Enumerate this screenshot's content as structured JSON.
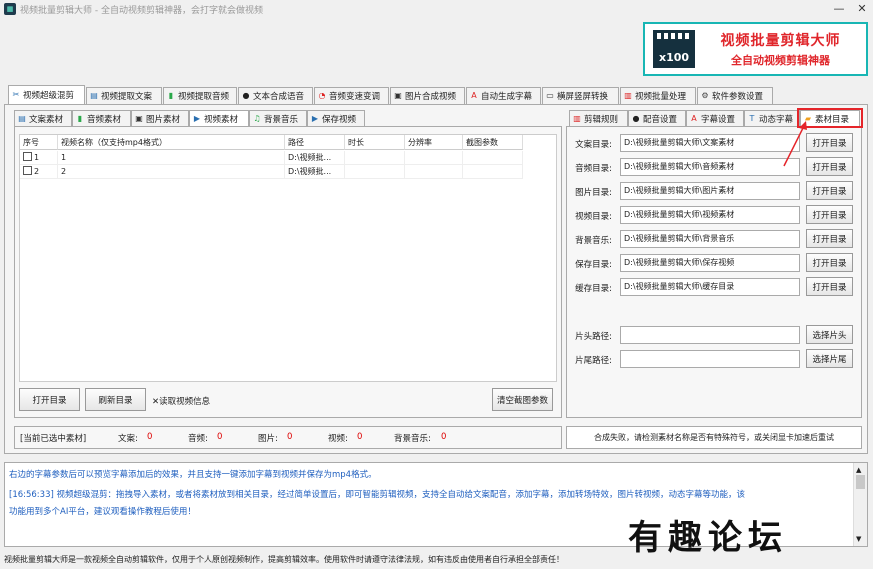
{
  "window": {
    "title": "视频批量剪辑大师 - 全自动视频剪辑神器，会打字就会做视频",
    "minimize": "—",
    "close": "✕"
  },
  "banner": {
    "logo": "x100",
    "title": "视频批量剪辑大师",
    "subtitle": "全自动视频剪辑神器",
    "accent": "#18b6b4",
    "title_color": "#e0262b"
  },
  "main_tabs": [
    {
      "label": "视频超级混剪",
      "icon": "scissors-icon",
      "glyph": "✂",
      "color": "#2a6fb0"
    },
    {
      "label": "视频提取文案",
      "icon": "doc-icon",
      "glyph": "▤",
      "color": "#2a6fb0"
    },
    {
      "label": "视频提取音频",
      "icon": "waveform-icon",
      "glyph": "▮",
      "color": "#2aa84a"
    },
    {
      "label": "文本合成语音",
      "icon": "microphone-icon",
      "glyph": "●",
      "color": "#222"
    },
    {
      "label": "音频变速变调",
      "icon": "gauge-icon",
      "glyph": "◔",
      "color": "#d22"
    },
    {
      "label": "图片合成视频",
      "icon": "image-icon",
      "glyph": "▣",
      "color": "#333"
    },
    {
      "label": "自动生成字幕",
      "icon": "text-icon",
      "glyph": "A",
      "color": "#d22"
    },
    {
      "label": "横屏竖屏转换",
      "icon": "screen-icon",
      "glyph": "▭",
      "color": "#333"
    },
    {
      "label": "视频批量处理",
      "icon": "film-icon",
      "glyph": "▥",
      "color": "#d22"
    },
    {
      "label": "软件参数设置",
      "icon": "gear-icon",
      "glyph": "⚙",
      "color": "#444"
    }
  ],
  "left_tabs": [
    {
      "label": "文案素材",
      "icon": "doc-icon",
      "glyph": "▤",
      "color": "#2a6fb0"
    },
    {
      "label": "音频素材",
      "icon": "waveform-icon",
      "glyph": "▮",
      "color": "#2aa84a"
    },
    {
      "label": "图片素材",
      "icon": "image-icon",
      "glyph": "▣",
      "color": "#333"
    },
    {
      "label": "视频素材",
      "icon": "play-icon",
      "glyph": "▶",
      "color": "#2a6fb0"
    },
    {
      "label": "背景音乐",
      "icon": "music-icon",
      "glyph": "♫",
      "color": "#2aa84a"
    },
    {
      "label": "保存视频",
      "icon": "save-icon",
      "glyph": "▶",
      "color": "#2a6fb0"
    }
  ],
  "grid": {
    "columns": [
      "序号",
      "视频名称（仅支持mp4格式）",
      "路径",
      "时长",
      "分辨率",
      "截图参数"
    ],
    "rows": [
      {
        "index": "1",
        "name": "1",
        "path": "D:\\视频批..."
      },
      {
        "index": "2",
        "name": "2",
        "path": "D:\\视频批..."
      }
    ]
  },
  "left_buttons": {
    "open": "打开目录",
    "refresh": "刷新目录",
    "read_info": "✕读取视频信息",
    "clear": "清空截图参数"
  },
  "status": {
    "label": "[当前已选中素材]",
    "text_label": "文案:",
    "text_count": "0",
    "audio_label": "音频:",
    "audio_count": "0",
    "image_label": "图片:",
    "image_count": "0",
    "video_label": "视频:",
    "video_count": "0",
    "music_label": "背景音乐:",
    "music_count": "0"
  },
  "right_tabs": [
    {
      "label": "剪辑规则",
      "icon": "film-icon",
      "glyph": "▥",
      "color": "#d22"
    },
    {
      "label": "配音设置",
      "icon": "microphone-icon",
      "glyph": "●",
      "color": "#222"
    },
    {
      "label": "字幕设置",
      "icon": "text-icon",
      "glyph": "A",
      "color": "#d22"
    },
    {
      "label": "动态字幕",
      "icon": "text-box-icon",
      "glyph": "T",
      "color": "#2a6fb0"
    },
    {
      "label": "素材目录",
      "icon": "folder-icon",
      "glyph": "▰",
      "color": "#f0a020"
    }
  ],
  "dirs": [
    {
      "label": "文案目录:",
      "path": "D:\\视频批量剪辑大师\\文案素材",
      "button": "打开目录"
    },
    {
      "label": "音频目录:",
      "path": "D:\\视频批量剪辑大师\\音频素材",
      "button": "打开目录"
    },
    {
      "label": "图片目录:",
      "path": "D:\\视频批量剪辑大师\\图片素材",
      "button": "打开目录"
    },
    {
      "label": "视频目录:",
      "path": "D:\\视频批量剪辑大师\\视频素材",
      "button": "打开目录"
    },
    {
      "label": "背景音乐:",
      "path": "D:\\视频批量剪辑大师\\背景音乐",
      "button": "打开目录"
    },
    {
      "label": "保存目录:",
      "path": "D:\\视频批量剪辑大师\\保存视频",
      "button": "打开目录"
    },
    {
      "label": "缓存目录:",
      "path": "D:\\视频批量剪辑大师\\缓存目录",
      "button": "打开目录"
    }
  ],
  "clips": [
    {
      "label": "片头路径:",
      "path": "",
      "button": "选择片头"
    },
    {
      "label": "片尾路径:",
      "path": "",
      "button": "选择片尾"
    }
  ],
  "fail_message": "合成失败，请检测素材名称是否有特殊符号，或关闭显卡加速后重试",
  "log": [
    "右边的字幕参数后可以预览字幕添加后的效果，并且支持一键添加字幕到视频并保存为mp4格式。",
    "[16:56:33] 视频超级混剪：拖拽导入素材，或者将素材放到相关目录，经过简单设置后，即可智能剪辑视频，支持全自动给文案配音，添加字幕，添加转场特效，图片转视频，动态字幕等功能，该",
    "功能用到多个AI平台，建议观看操作教程后使用！"
  ],
  "footer": "视频批量剪辑大师是一款视频全自动剪辑软件，仅用于个人原创视频制作，提高剪辑效率。使用软件时请遵守法律法规，如有违反由使用者自行承担全部责任！",
  "watermark": "有趣论坛"
}
